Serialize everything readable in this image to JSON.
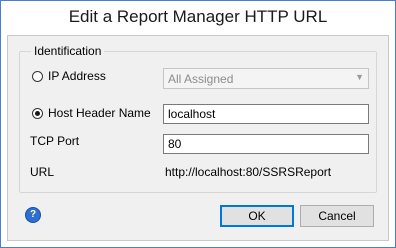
{
  "window": {
    "title": "Edit a Report Manager HTTP URL"
  },
  "identification": {
    "legend": "Identification",
    "ip_address": {
      "label": "IP Address",
      "selected": false,
      "value": "All Assigned"
    },
    "host_header": {
      "label": "Host Header Name",
      "selected": true,
      "value": "localhost"
    },
    "tcp_port": {
      "label": "TCP Port",
      "value": "80"
    },
    "url": {
      "label": "URL",
      "value": "http://localhost:80/SSRSReport"
    }
  },
  "buttons": {
    "ok": "OK",
    "cancel": "Cancel"
  },
  "help": {
    "icon": "help-icon",
    "glyph": "?"
  }
}
